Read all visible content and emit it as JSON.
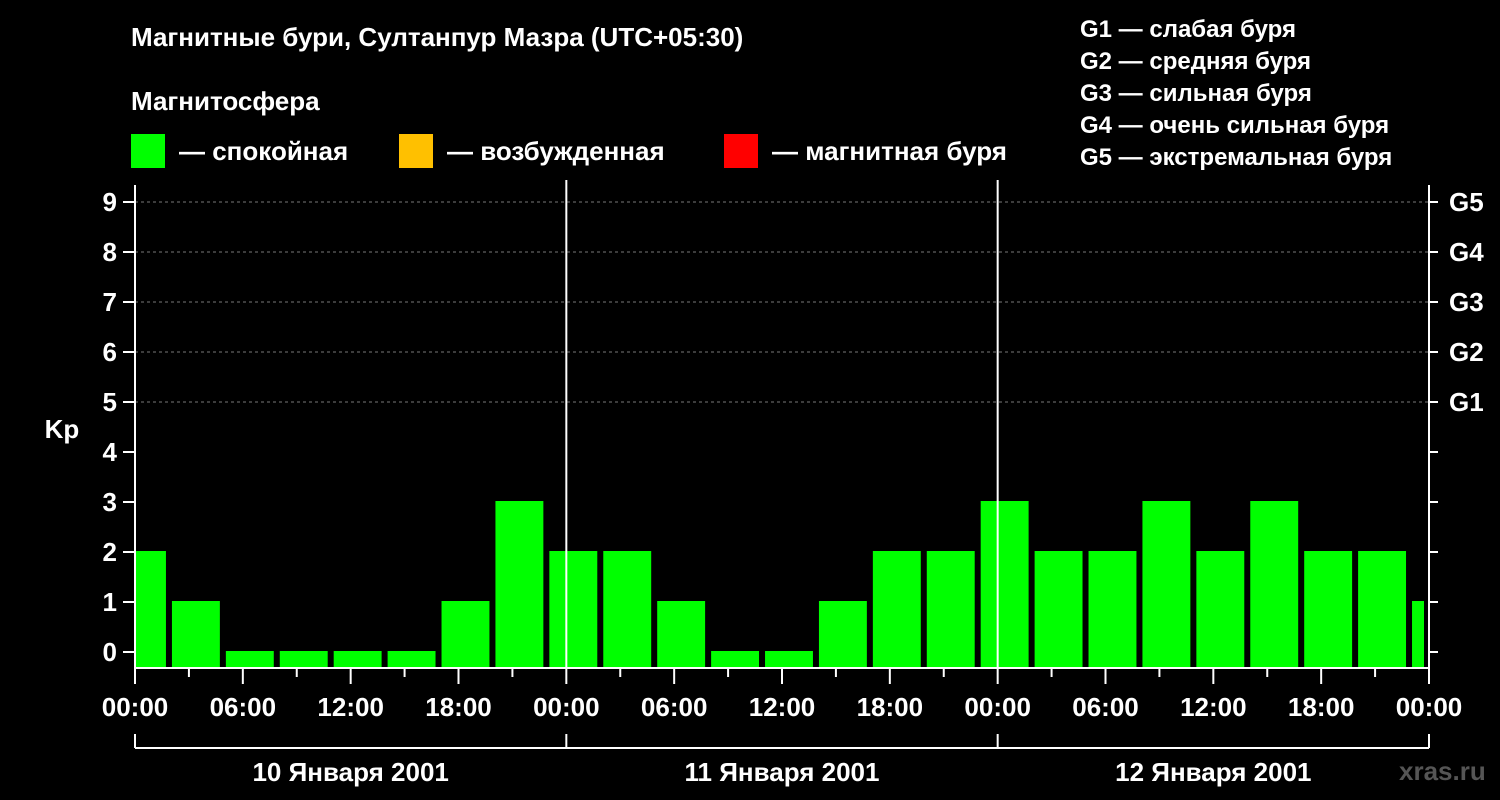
{
  "header": {
    "title": "Магнитные бури, Султанпур Мазра (UTC+05:30)",
    "subtitle": "Магнитосфера"
  },
  "legend": {
    "items": [
      {
        "label": "— спокойная",
        "color": "#00ff00"
      },
      {
        "label": "— возбужденная",
        "color": "#ffc000"
      },
      {
        "label": "— магнитная буря",
        "color": "#ff0000"
      }
    ]
  },
  "storm_levels": [
    "G1 — слабая буря",
    "G2 — средняя буря",
    "G3 — сильная буря",
    "G4 — очень сильная буря",
    "G5 — экстремальная буря"
  ],
  "watermark": "xras.ru",
  "chart_data": {
    "type": "bar",
    "ylabel": "Kp",
    "ylim": [
      0,
      9
    ],
    "yticks": [
      "0",
      "1",
      "2",
      "3",
      "4",
      "5",
      "6",
      "7",
      "8",
      "9"
    ],
    "right_ticks": [
      {
        "label": "G1",
        "value": 5
      },
      {
        "label": "G2",
        "value": 6
      },
      {
        "label": "G3",
        "value": 7
      },
      {
        "label": "G4",
        "value": 8
      },
      {
        "label": "G5",
        "value": 9
      }
    ],
    "xtick_labels": [
      "00:00",
      "06:00",
      "12:00",
      "18:00",
      "00:00",
      "06:00",
      "12:00",
      "18:00",
      "00:00",
      "06:00",
      "12:00",
      "18:00",
      "00:00"
    ],
    "days": [
      "10 Января 2001",
      "11 Января 2001",
      "12 Января 2001"
    ],
    "bars": [
      {
        "start": "10 Января 2001 00:00",
        "hours": 2,
        "value": 2
      },
      {
        "start": "10 Января 2001 02:00",
        "hours": 3,
        "value": 1
      },
      {
        "start": "10 Января 2001 05:00",
        "hours": 3,
        "value": 0
      },
      {
        "start": "10 Января 2001 08:00",
        "hours": 3,
        "value": 0
      },
      {
        "start": "10 Января 2001 11:00",
        "hours": 3,
        "value": 0
      },
      {
        "start": "10 Января 2001 14:00",
        "hours": 3,
        "value": 0
      },
      {
        "start": "10 Января 2001 17:00",
        "hours": 3,
        "value": 1
      },
      {
        "start": "10 Января 2001 20:00",
        "hours": 3,
        "value": 3
      },
      {
        "start": "10 Января 2001 23:00",
        "hours": 3,
        "value": 2
      },
      {
        "start": "11 Января 2001 02:00",
        "hours": 3,
        "value": 2
      },
      {
        "start": "11 Января 2001 05:00",
        "hours": 3,
        "value": 1
      },
      {
        "start": "11 Января 2001 08:00",
        "hours": 3,
        "value": 0
      },
      {
        "start": "11 Января 2001 11:00",
        "hours": 3,
        "value": 0
      },
      {
        "start": "11 Января 2001 14:00",
        "hours": 3,
        "value": 1
      },
      {
        "start": "11 Января 2001 17:00",
        "hours": 3,
        "value": 2
      },
      {
        "start": "11 Января 2001 20:00",
        "hours": 3,
        "value": 2
      },
      {
        "start": "11 Января 2001 23:00",
        "hours": 3,
        "value": 3
      },
      {
        "start": "12 Января 2001 02:00",
        "hours": 3,
        "value": 2
      },
      {
        "start": "12 Января 2001 05:00",
        "hours": 3,
        "value": 2
      },
      {
        "start": "12 Января 2001 08:00",
        "hours": 3,
        "value": 3
      },
      {
        "start": "12 Января 2001 11:00",
        "hours": 3,
        "value": 2
      },
      {
        "start": "12 Января 2001 14:00",
        "hours": 3,
        "value": 3
      },
      {
        "start": "12 Января 2001 17:00",
        "hours": 3,
        "value": 2
      },
      {
        "start": "12 Января 2001 20:00",
        "hours": 3,
        "value": 2
      },
      {
        "start": "12 Января 2001 23:00",
        "hours": 1,
        "value": 1
      }
    ],
    "colors": {
      "quiet": "#00ff00",
      "active": "#ffc000",
      "storm": "#ff0000"
    },
    "grid": true
  }
}
